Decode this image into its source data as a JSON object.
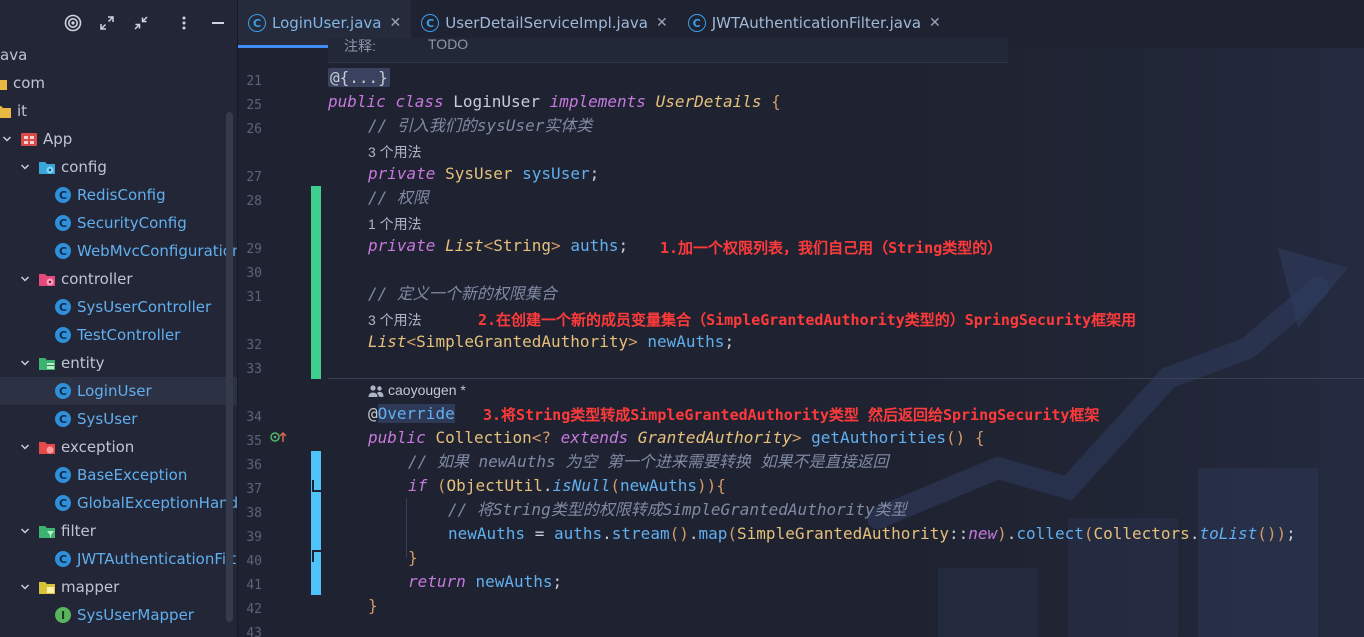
{
  "sidebar": {
    "toolbar": {
      "locate_icon": "target-icon",
      "expand_icon": "expand-icon",
      "collapse_icon": "collapse-icon",
      "options_icon": "more-vertical-icon",
      "hide_icon": "minimize-icon"
    },
    "tree": [
      {
        "label": "ava",
        "kind": "text"
      },
      {
        "label": "com",
        "kind": "folder"
      },
      {
        "label": "it",
        "kind": "folder"
      },
      {
        "label": "App",
        "kind": "module",
        "expanded": true
      },
      {
        "label": "config",
        "kind": "config-pkg",
        "expanded": true
      },
      {
        "label": "RedisConfig",
        "kind": "class"
      },
      {
        "label": "SecurityConfig",
        "kind": "class"
      },
      {
        "label": "WebMvcConfiguration",
        "kind": "class"
      },
      {
        "label": "controller",
        "kind": "controller-pkg",
        "expanded": true
      },
      {
        "label": "SysUserController",
        "kind": "class"
      },
      {
        "label": "TestController",
        "kind": "class"
      },
      {
        "label": "entity",
        "kind": "entity-pkg",
        "expanded": true
      },
      {
        "label": "LoginUser",
        "kind": "class",
        "selected": true
      },
      {
        "label": "SysUser",
        "kind": "class"
      },
      {
        "label": "exception",
        "kind": "exception-pkg",
        "expanded": true
      },
      {
        "label": "BaseException",
        "kind": "class"
      },
      {
        "label": "GlobalExceptionHandle",
        "kind": "class"
      },
      {
        "label": "filter",
        "kind": "filter-pkg",
        "expanded": true
      },
      {
        "label": "JWTAuthenticationFilter",
        "kind": "class"
      },
      {
        "label": "mapper",
        "kind": "mapper-pkg",
        "expanded": true
      },
      {
        "label": "SysUserMapper",
        "kind": "interface"
      }
    ]
  },
  "tabs": [
    {
      "label": "LoginUser.java",
      "active": true
    },
    {
      "label": "UserDetailServiceImpl.java",
      "active": false
    },
    {
      "label": "JWTAuthenticationFilter.java",
      "active": false
    }
  ],
  "editor": {
    "top_doc": {
      "label": "注释:",
      "value": "TODO"
    },
    "line_numbers": [
      "21",
      "25",
      "26",
      "27",
      "28",
      "29",
      "30",
      "31",
      "32",
      "33",
      "34",
      "35",
      "36",
      "37",
      "38",
      "39",
      "40",
      "41",
      "42",
      "43"
    ],
    "usage_hints": {
      "sysuser": "3 个用法",
      "auths": "1 个用法",
      "newauths": "3 个用法"
    },
    "author_hint": "caoyougen *",
    "annotations": {
      "a1": "1.加一个权限列表，我们自己用（String类型的）",
      "a2": "2.在创建一个新的成员变量集合（SimpleGrantedAuthority类型的）SpringSecurity框架用",
      "a3": "3.将String类型转成SimpleGrantedAuthority类型 然后返回给SpringSecurity框架"
    },
    "code": {
      "fold": "@{...}",
      "l25_kw1": "public",
      "l25_kw2": "class",
      "l25_name": "LoginUser",
      "l25_kw3": "implements",
      "l25_iface": "UserDetails",
      "l25_brace": "{",
      "c26": "// 引入我们的sysUser实体类",
      "l27_kw": "private",
      "l27_type": "SysUser",
      "l27_field": "sysUser",
      "l27_semi": ";",
      "c28": "// 权限",
      "l29_kw": "private",
      "l29_type": "List",
      "l29_lt": "<",
      "l29_generic": "String",
      "l29_gt": ">",
      "l29_field": "auths",
      "l29_semi": ";",
      "c31": "// 定义一个新的权限集合",
      "l32_type": "List",
      "l32_lt": "<",
      "l32_generic": "SimpleGrantedAuthority",
      "l32_gt": ">",
      "l32_field": "newAuths",
      "l32_semi": ";",
      "l34_at": "@",
      "l34_ann": "Override",
      "l35_kw": "public",
      "l35_type": "Collection",
      "l35_gen1": "<?",
      "l35_ext": "extends",
      "l35_gen2": "GrantedAuthority",
      "l35_gen3": ">",
      "l35_fn": "getAuthorities",
      "l35_paren": "()",
      "l35_brace": "{",
      "c36": "// 如果 newAuths 为空 第一个进来需要转换 如果不是直接返回",
      "l37_kw": "if",
      "l37_p1": "(",
      "l37_cls": "ObjectUtil",
      "l37_dot": ".",
      "l37_fn": "isNull",
      "l37_p2": "(",
      "l37_arg": "newAuths",
      "l37_p3": "))",
      "l37_brace": "{",
      "c38": "// 将String类型的权限转成SimpleGrantedAuthority类型",
      "l39_lhs": "newAuths",
      "l39_eq": " = ",
      "l39_src": "auths",
      "l39_d1": ".",
      "l39_stream": "stream",
      "l39_p1": "()",
      "l39_d2": ".",
      "l39_map": "map",
      "l39_p2": "(",
      "l39_cls": "SimpleGrantedAuthority",
      "l39_ref": "::",
      "l39_new": "new",
      "l39_p3": ")",
      "l39_d3": ".",
      "l39_collect": "collect",
      "l39_p4": "(",
      "l39_colls": "Collectors",
      "l39_d4": ".",
      "l39_tolist": "toList",
      "l39_p5": "())",
      "l39_semi": ";",
      "l40_brace": "}",
      "l41_kw": "return",
      "l41_val": "newAuths",
      "l41_semi": ";",
      "l42_brace": "}"
    }
  },
  "colors": {
    "background": "#1f2331",
    "sidebar": "#222636",
    "keyword": "#c678dd",
    "type": "#e5c07b",
    "field": "#61afef",
    "comment": "#7f8aa3",
    "annotation_red": "#ff3a3a",
    "vcs_added": "#3ecf8e",
    "vcs_modified": "#4fc3f7",
    "active_tab_underline": "#3f8df4"
  }
}
